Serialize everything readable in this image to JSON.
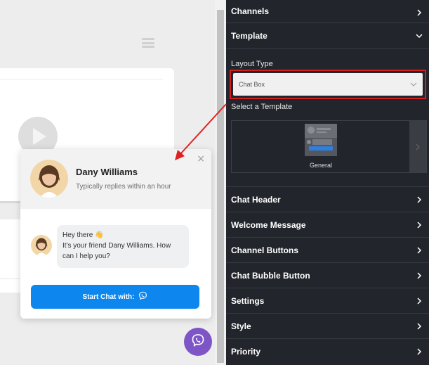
{
  "chat": {
    "name": "Dany Williams",
    "status": "Typically replies within an hour",
    "message_line1": "Hey there 👋",
    "message_line2": "It's your friend Dany Williams. How can I help you?",
    "start_button": "Start Chat with:",
    "close_icon": "×"
  },
  "panel": {
    "sections": {
      "channels": "Channels",
      "template": "Template",
      "chat_header": "Chat Header",
      "welcome_message": "Welcome Message",
      "channel_buttons": "Channel Buttons",
      "chat_bubble_button": "Chat Bubble Button",
      "settings": "Settings",
      "style": "Style",
      "priority": "Priority"
    },
    "layout_type_label": "Layout Type",
    "layout_type_value": "Chat Box",
    "select_template_label": "Select a Template",
    "template_name": "General"
  },
  "colors": {
    "panel_bg": "#22252b",
    "accent_blue": "#0d87ee",
    "viber_purple": "#7d55c7",
    "highlight_red": "#d41f1f"
  },
  "icons": [
    "hamburger-icon",
    "play-icon",
    "close-icon",
    "viber-icon",
    "chevron-right-icon",
    "chevron-down-icon"
  ]
}
